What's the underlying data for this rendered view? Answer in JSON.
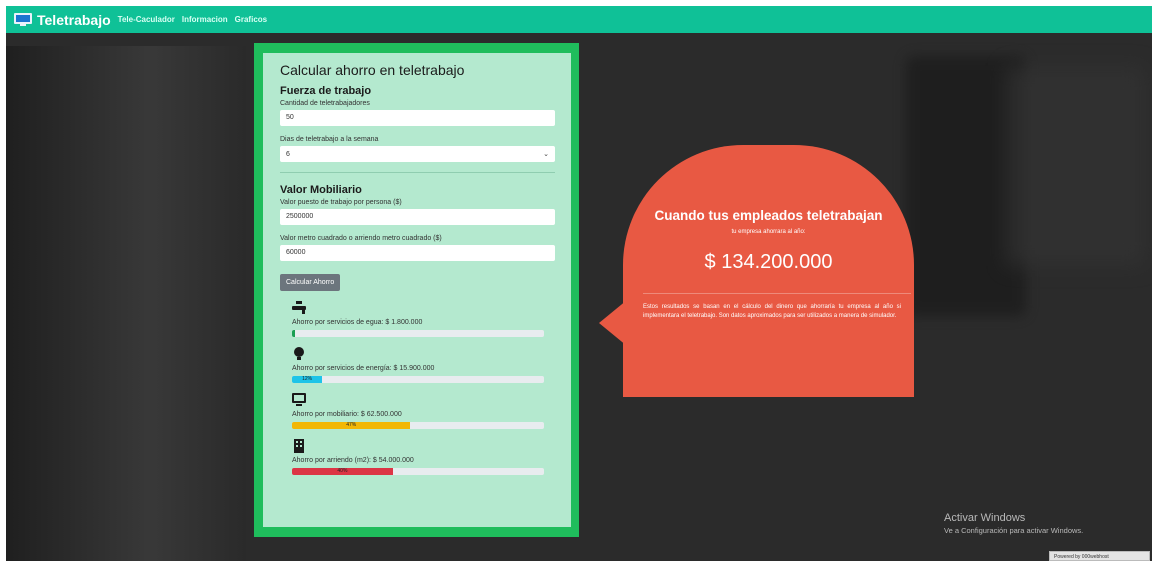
{
  "navbar": {
    "brand": "Teletrabajo",
    "links": [
      "Tele-Caculador",
      "Informacion",
      "Graficos"
    ]
  },
  "form": {
    "title": "Calcular ahorro en teletrabajo",
    "section1_title": "Fuerza de trabajo",
    "workers_label": "Cantidad de teletrabajadores",
    "workers_value": "50",
    "days_label": "Dias de teletrabajo a la semana",
    "days_value": "6",
    "section2_title": "Valor Mobiliario",
    "workstation_label": "Valor puesto de trabajo por persona ($)",
    "workstation_value": "2500000",
    "sqm_label": "Valor metro cuadrado o arriendo metro cuadrado ($)",
    "sqm_value": "60000",
    "button_label": "Calcular Ahorro"
  },
  "savings": [
    {
      "icon": "faucet-icon",
      "text": "Ahorro por servicios de egua: $ 1.800.000",
      "percent": 1,
      "bar_label": "",
      "color": "#1a9f53"
    },
    {
      "icon": "lightbulb-icon",
      "text": "Ahorro por servicios de energía: $ 15.900.000",
      "percent": 12,
      "bar_label": "12%",
      "color": "#1ec4e8"
    },
    {
      "icon": "monitor-icon",
      "text": "Ahorro por mobiliario: $ 62.500.000",
      "percent": 47,
      "bar_label": "47%",
      "color": "#f2b705"
    },
    {
      "icon": "building-icon",
      "text": "Ahorro por arriendo (m2): $ 54.000.000",
      "percent": 40,
      "bar_label": "40%",
      "color": "#dc3545"
    }
  ],
  "result": {
    "title": "Cuando tus empleados teletrabajan",
    "subtitle": "tu empresa ahorrara al año:",
    "amount": "$ 134.200.000",
    "note": "Estos resultados se basan en el cálculo del dinero que ahorraría tu empresa al año si implementara el teletrabajo. Son datos aproximados para ser utilizados a manera de simulador."
  },
  "windows_watermark": {
    "title": "Activar Windows",
    "subtitle": "Ve a Configuración para activar Windows."
  },
  "powered_by": "Powered by 000webhost",
  "colors": {
    "navbar": "#0fc197",
    "form_border": "#1fbd5c",
    "card_bg": "#b4e9cf",
    "bubble": "#e85943",
    "button": "#6c757d"
  }
}
